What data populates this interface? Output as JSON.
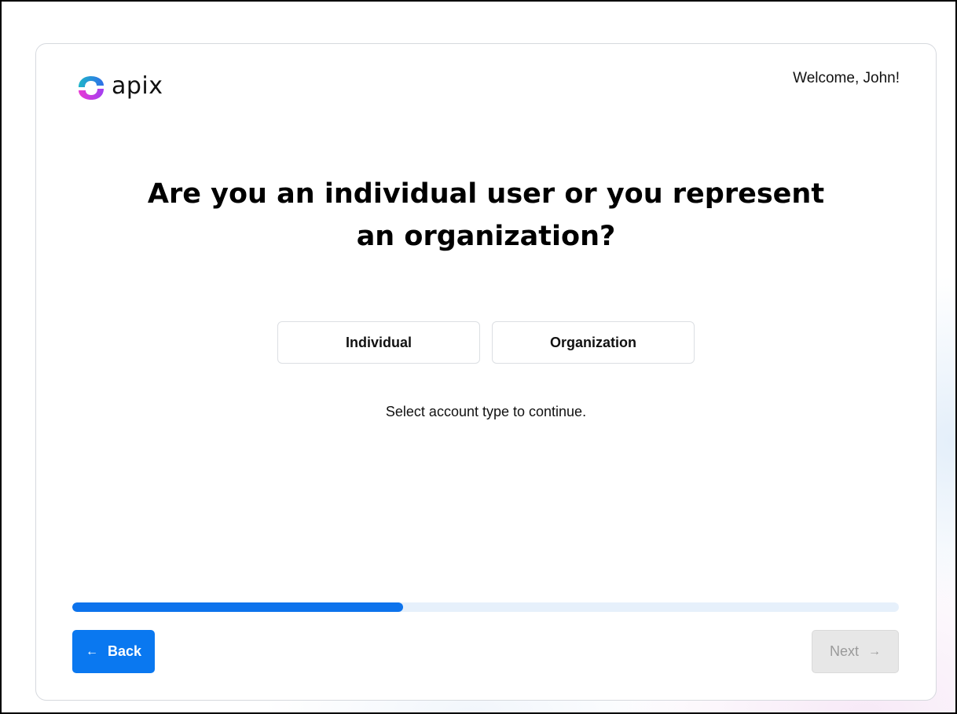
{
  "brand": {
    "name": "apix",
    "colors": {
      "teal": "#1fb5c9",
      "blue": "#2f6fe8",
      "magenta": "#e83ad4",
      "purple": "#a23ff0"
    }
  },
  "header": {
    "welcome_text": "Welcome, John!"
  },
  "main": {
    "question": "Are you an individual user or you represent an organization?",
    "options": [
      {
        "label": "Individual"
      },
      {
        "label": "Organization"
      }
    ],
    "hint": "Select account type to continue."
  },
  "progress": {
    "fraction": 0.4,
    "fill_color": "#0d73ec",
    "track_color": "#e6f0fb"
  },
  "footer": {
    "back": {
      "label": "Back",
      "icon": "arrow-left-icon"
    },
    "next": {
      "label": "Next",
      "icon": "arrow-right-icon",
      "disabled": true
    }
  }
}
